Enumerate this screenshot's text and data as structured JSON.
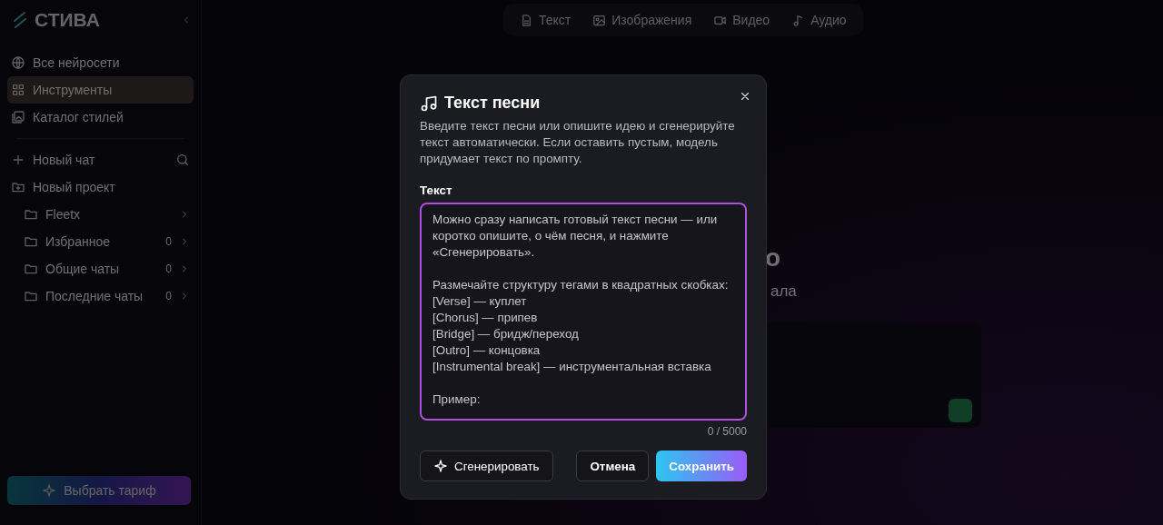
{
  "sidebar": {
    "logo": "СТИВА",
    "nav": [
      {
        "label": "Все нейросети",
        "selected": false
      },
      {
        "label": "Инструменты",
        "selected": true
      },
      {
        "label": "Каталог стилей",
        "selected": false
      }
    ],
    "new_chat": "Новый чат",
    "new_project": "Новый проект",
    "folders": [
      {
        "label": "Fleetx"
      },
      {
        "label": "Избранное",
        "count": "0"
      },
      {
        "label": "Общие чаты",
        "count": "0"
      },
      {
        "label": "Последние чаты",
        "count": "0"
      }
    ],
    "plan_button": "Выбрать тариф"
  },
  "top_tabs": [
    {
      "label": "Текст",
      "selected": false
    },
    {
      "label": "Изображения",
      "selected": false
    },
    {
      "label": "Видео",
      "selected": false
    },
    {
      "label": "Аудио",
      "selected": false
    }
  ],
  "main": {
    "heading_fragment": "о",
    "subheading_fragment": "ала"
  },
  "dialog": {
    "title": "Текст песни",
    "description": "Введите текст песни или опишите идею и сгенерируйте текст автоматически. Если оставить пустым, модель придумает текст по промпту.",
    "field_label": "Текст",
    "placeholder": "Можно сразу написать готовый текст песни — или коротко опишите, о чём песня, и нажмите «Сгенерировать».\n\nРазмечайте структуру тегами в квадратных скобках:\n[Verse] — куплет\n[Chorus] — припев\n[Bridge] — бридж/переход\n[Outro] — концовка\n[Instrumental break] — инструментальная вставка\n\nПример:",
    "counter": "0 / 5000",
    "generate_button": "Сгенерировать",
    "cancel_button": "Отмена",
    "save_button": "Сохранить"
  }
}
